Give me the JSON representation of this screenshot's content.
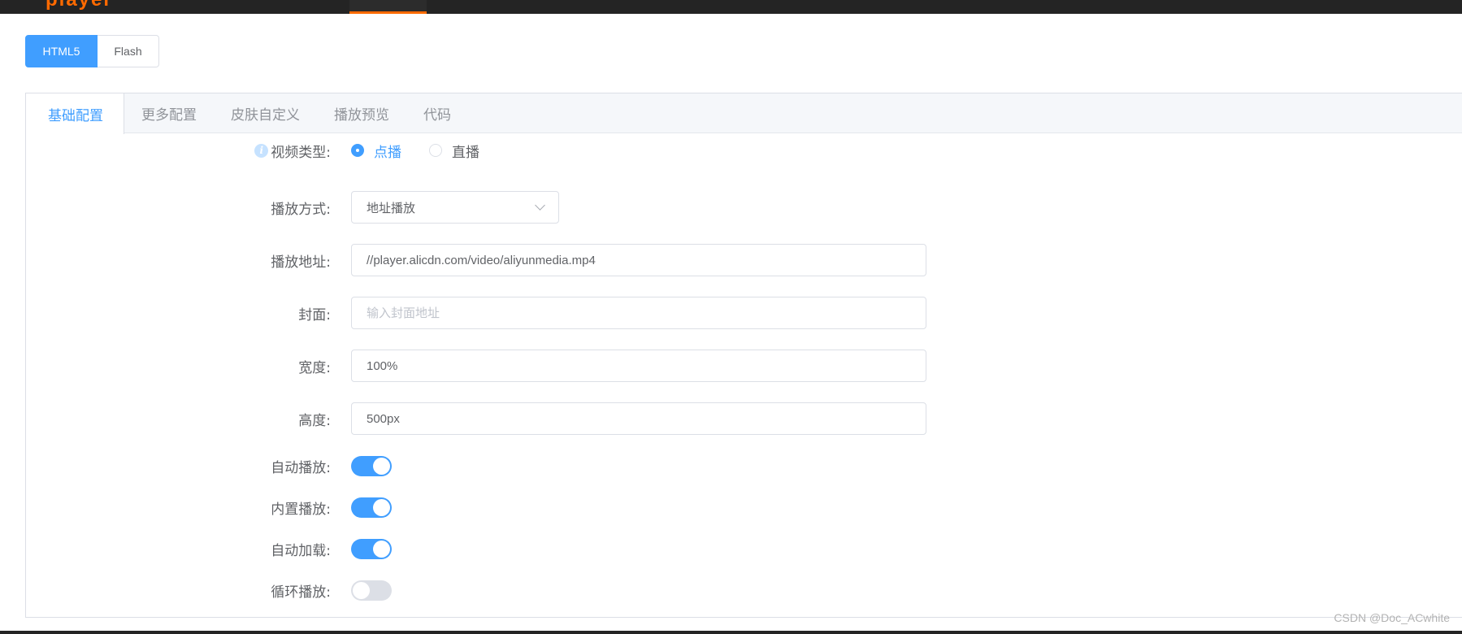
{
  "header": {
    "logo_fragment": "player",
    "accent_color": "#ff6a00"
  },
  "mode_switch": {
    "options": [
      "HTML5",
      "Flash"
    ],
    "active": "HTML5"
  },
  "tabs": [
    {
      "label": "基础配置",
      "active": true
    },
    {
      "label": "更多配置",
      "active": false
    },
    {
      "label": "皮肤自定义",
      "active": false
    },
    {
      "label": "播放预览",
      "active": false
    },
    {
      "label": "代码",
      "active": false
    }
  ],
  "form": {
    "video_type": {
      "label": "视频类型:",
      "info_icon": "info-icon",
      "options": [
        "点播",
        "直播"
      ],
      "selected": "点播"
    },
    "play_mode": {
      "label": "播放方式:",
      "value": "地址播放"
    },
    "source": {
      "label": "播放地址:",
      "value": "//player.alicdn.com/video/aliyunmedia.mp4"
    },
    "cover": {
      "label": "封面:",
      "value": "",
      "placeholder": "输入封面地址"
    },
    "width": {
      "label": "宽度:",
      "value": "100%"
    },
    "height": {
      "label": "高度:",
      "value": "500px"
    },
    "autoplay": {
      "label": "自动播放:",
      "on": true
    },
    "inline": {
      "label": "内置播放:",
      "on": true
    },
    "preload": {
      "label": "自动加载:",
      "on": true
    },
    "loop": {
      "label": "循环播放:",
      "on": false
    }
  },
  "colors": {
    "primary": "#409eff",
    "border": "#dcdfe6"
  },
  "watermark": "CSDN @Doc_ACwhite"
}
